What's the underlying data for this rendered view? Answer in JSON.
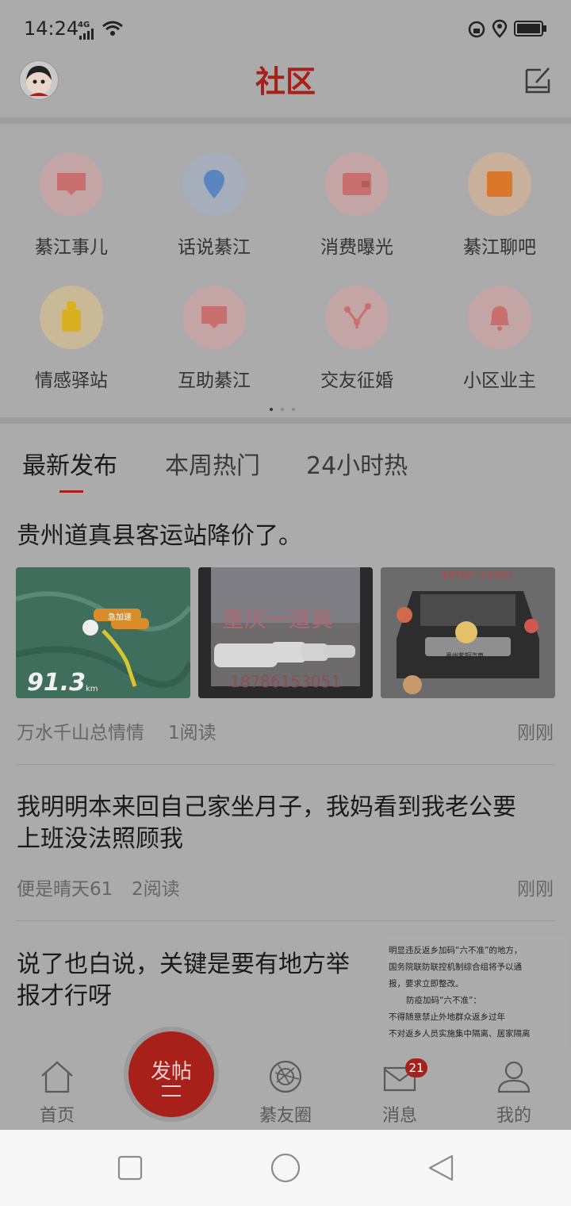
{
  "status_bar": {
    "time": "14:24",
    "network": "4G"
  },
  "header": {
    "title": "社区"
  },
  "categories": [
    {
      "label": "綦江事儿",
      "icon": "chat-bubble-icon",
      "color": "#c9706f"
    },
    {
      "label": "话说綦江",
      "icon": "location-pin-icon",
      "color": "#5a86c0"
    },
    {
      "label": "消费曝光",
      "icon": "wallet-icon",
      "color": "#c9706f"
    },
    {
      "label": "綦江聊吧",
      "icon": "square-icon",
      "color": "#d9782a"
    },
    {
      "label": "情感驿站",
      "icon": "bottle-icon",
      "color": "#d8b020"
    },
    {
      "label": "互助綦江",
      "icon": "message-icon",
      "color": "#c9706f"
    },
    {
      "label": "交友征婚",
      "icon": "share-icon",
      "color": "#c9706f"
    },
    {
      "label": "小区业主",
      "icon": "bell-icon",
      "color": "#c9706f"
    }
  ],
  "tabs": [
    "最新发布",
    "本周热门",
    "24小时热"
  ],
  "posts": [
    {
      "title": "贵州道真县客运站降价了。",
      "author": "万水千山总情情",
      "reads": "1阅读",
      "time": "刚刚",
      "images": [
        {
          "overlay": "91.3",
          "unit": "km",
          "tag": "急加速"
        },
        {
          "overlay": "重庆一道真",
          "phone": "18786153051"
        },
        {
          "overlay": "18786153051",
          "plate": "贵州紫铜汽車"
        }
      ]
    },
    {
      "title_line1": "我明明本来回自己家坐月子，我妈看到我老公要",
      "title_line2": "上班没法照顾我",
      "author": "便是晴天61",
      "reads": "2阅读",
      "time": "刚刚"
    },
    {
      "title_line1": "说了也白说，关键是要有地方举",
      "title_line2": "报才行呀",
      "doc_lines": [
        "明显违反返乡加码“六不准”的地方，",
        "国务院联防联控机制综合组将予以通",
        "报，要求立即整改。",
        "防疫加码“六不准”：",
        "不得随意禁止外地群众返乡过年",
        "不对返乡人员实施集中隔离、居家隔离"
      ]
    }
  ],
  "bottom_nav": {
    "home": "首页",
    "post": "发帖",
    "circle": "綦友圈",
    "messages": "消息",
    "messages_badge": "21",
    "mine": "我的"
  }
}
